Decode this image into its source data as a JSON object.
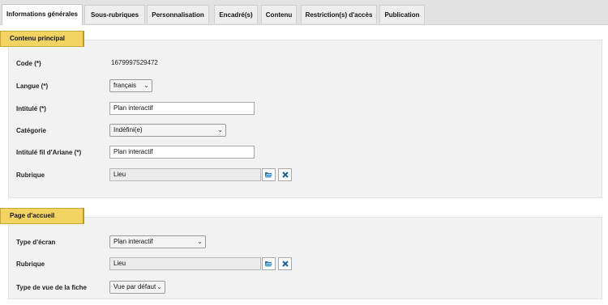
{
  "tabs": [
    {
      "label": "Informations générales"
    },
    {
      "label": "Sous-rubriques"
    },
    {
      "label": "Personnalisation"
    },
    {
      "label": "Encadré(s)"
    },
    {
      "label": "Contenu"
    },
    {
      "label": "Restriction(s) d'accès"
    },
    {
      "label": "Publication"
    }
  ],
  "main": {
    "title": "Contenu principal",
    "code_label": "Code (*)",
    "code_value": "1679997529472",
    "langue_label": "Langue (*)",
    "langue_value": "français",
    "intitule_label": "Intitulé (*)",
    "intitule_value": "Plan interactif",
    "categorie_label": "Catégorie",
    "categorie_value": "Indéfini(e)",
    "fil_label": "Intitulé fil d'Ariane (*)",
    "fil_value": "Plan interactif",
    "rubrique_label": "Rubrique",
    "rubrique_value": "Lieu"
  },
  "home": {
    "title": "Page d'accueil",
    "type_ecran_label": "Type d'écran",
    "type_ecran_value": "Plan interactif",
    "rubrique_label": "Rubrique",
    "rubrique_value": "Lieu",
    "vue_label": "Type de vue de la fiche",
    "vue_value": "Vue par défaut"
  },
  "colors": {
    "accent": "#f3d463",
    "browse_icon": "#2a7ab0",
    "clear_icon": "#1f5f99"
  }
}
